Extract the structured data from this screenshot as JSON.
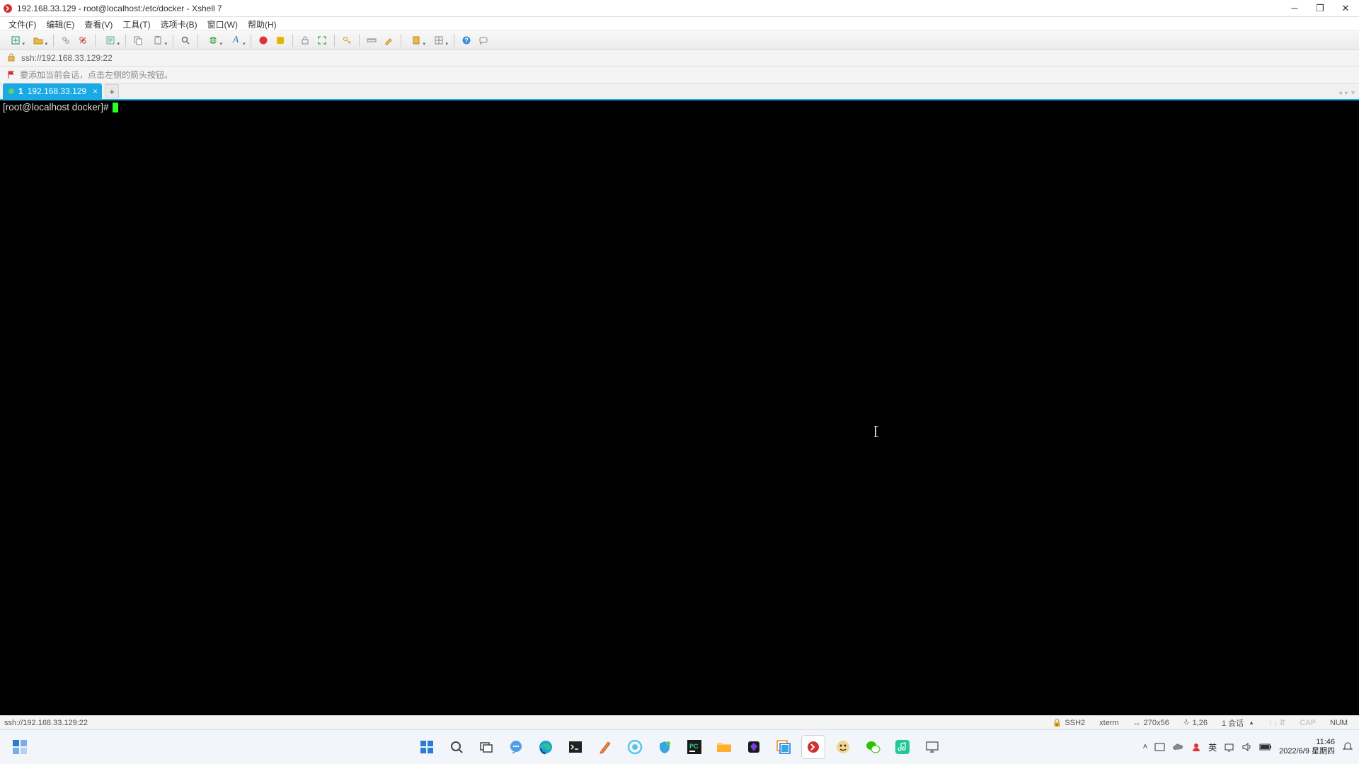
{
  "titlebar": {
    "title": "192.168.33.129 - root@localhost:/etc/docker - Xshell 7"
  },
  "menu": {
    "file": "文件(F)",
    "edit": "编辑(E)",
    "view": "查看(V)",
    "tools": "工具(T)",
    "tab": "选项卡(B)",
    "window": "窗口(W)",
    "help": "帮助(H)"
  },
  "toolbar_icons": {
    "new": "new-session-icon",
    "open": "open-icon",
    "link": "link-icon",
    "disconnect": "disconnect-icon",
    "props": "properties-icon",
    "copy": "copy-icon",
    "paste": "paste-icon",
    "find": "find-icon",
    "globe": "globe-icon",
    "font": "font-icon",
    "xshell1": "red-ball-icon",
    "xshell2": "yellow-square-icon",
    "lock": "lock-toolbar-icon",
    "fullscreen": "fullscreen-icon",
    "key": "key-icon",
    "ruler": "ruler-icon",
    "highlight": "highlighter-icon",
    "bookmark": "bookmark-icon",
    "layout": "layout-icon",
    "helpico": "help-circle-icon",
    "chat": "chat-icon"
  },
  "addressbar": {
    "url": "ssh://192.168.33.129:22"
  },
  "favbar": {
    "text": "要添加当前会话，点击左侧的箭头按钮。"
  },
  "tab": {
    "index": "1",
    "label": "192.168.33.129"
  },
  "terminal": {
    "prompt": "[root@localhost docker]# "
  },
  "statusbar": {
    "conn": "ssh://192.168.33.129:22",
    "proto": "SSH2",
    "term": "xterm",
    "size": "270x56",
    "pos": "1,26",
    "sessions": "1 会话",
    "cap": "CAP",
    "num": "NUM"
  },
  "taskbar_icons": {
    "widgets": "widgets-icon",
    "start": "windows-start-icon",
    "search": "search-icon",
    "taskview": "taskview-icon",
    "chat": "teams-chat-icon",
    "edge": "edge-icon",
    "cmd": "terminal-icon",
    "pen": "pen-icon",
    "browser": "browser-icon",
    "shield": "shield-icon",
    "pycharm": "pycharm-icon",
    "explorer": "file-explorer-icon",
    "obsidian": "obsidian-icon",
    "vmware": "vmware-icon",
    "xshell": "xshell-app-icon",
    "app1": "app-icon-1",
    "wechat": "wechat-icon",
    "music": "music-icon",
    "sys": "system-icon"
  },
  "tray": {
    "ime_lang": "英",
    "time": "11:46",
    "date": "2022/6/9 星期四"
  }
}
